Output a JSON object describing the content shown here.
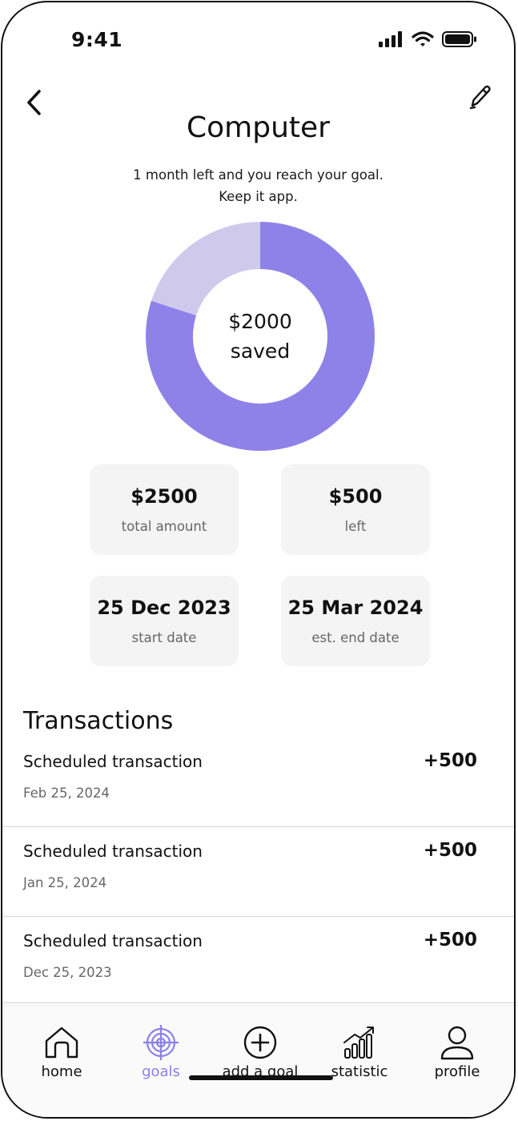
{
  "status_bar": {
    "time": "9:41"
  },
  "header": {
    "title": "Computer",
    "subtitle_line1": "1 month left and you reach your goal.",
    "subtitle_line2": "Keep it app."
  },
  "progress": {
    "saved_amount": "$2000",
    "saved_label": "saved",
    "saved_fraction": 0.8,
    "colors": {
      "saved": "#8e82e9",
      "remaining": "#cfcaec"
    }
  },
  "stats": {
    "total_amount_value": "$2500",
    "total_amount_label": "total amount",
    "left_value": "$500",
    "left_label": "left",
    "start_date_value": "25 Dec 2023",
    "start_date_label": "start date",
    "end_date_value": "25 Mar 2024",
    "end_date_label": "est. end date"
  },
  "transactions": {
    "title": "Transactions",
    "items": [
      {
        "name": "Scheduled transaction",
        "date": "Feb 25, 2024",
        "amount": "+500"
      },
      {
        "name": "Scheduled transaction",
        "date": "Jan 25, 2024",
        "amount": "+500"
      },
      {
        "name": "Scheduled transaction",
        "date": "Dec 25, 2023",
        "amount": "+500"
      }
    ]
  },
  "tab_bar": {
    "accent_color": "#8b80e8",
    "tabs": [
      {
        "label": "home",
        "icon": "home-icon"
      },
      {
        "label": "goals",
        "icon": "target-icon",
        "active": true
      },
      {
        "label": "add a goal",
        "icon": "plus-circle-icon"
      },
      {
        "label": "statistic",
        "icon": "bar-chart-icon"
      },
      {
        "label": "profile",
        "icon": "user-icon"
      }
    ]
  }
}
